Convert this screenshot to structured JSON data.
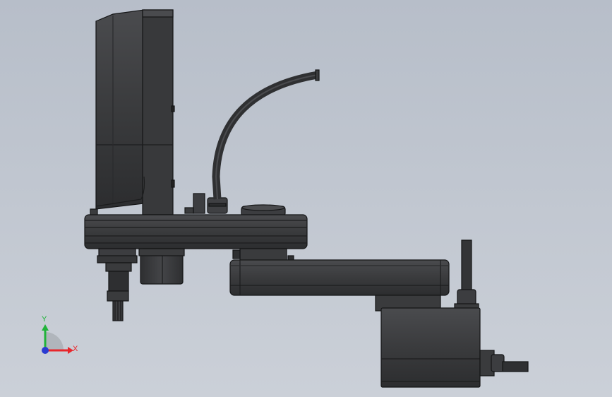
{
  "scene": {
    "background_top": "#b8bfc9",
    "background_bottom": "#c9ced6",
    "model_color": "#3a3b3d",
    "model_dark": "#2a2b2d",
    "model_edge": "#151617",
    "model_highlight": "#55575a"
  },
  "triad": {
    "x_label": "X",
    "y_label": "Y",
    "x_color": "#e8262b",
    "y_color": "#21b33a",
    "origin_color": "#2b3bd1"
  }
}
